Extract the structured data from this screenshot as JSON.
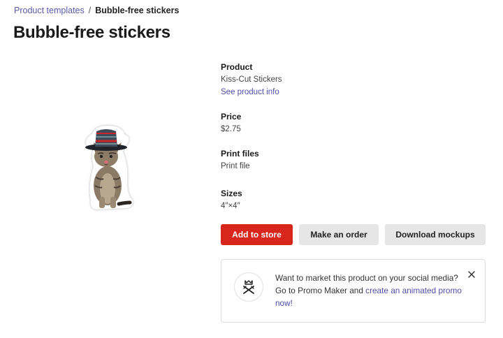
{
  "breadcrumb": {
    "parent": "Product templates",
    "separator": "/",
    "current": "Bubble-free stickers"
  },
  "page_title": "Bubble-free stickers",
  "product_image": {
    "icon": "kitten-sticker-image"
  },
  "info": {
    "product_label": "Product",
    "product_value": "Kiss-Cut Stickers",
    "product_link": "See product info",
    "price_label": "Price",
    "price_value": "$2.75",
    "print_files_label": "Print files",
    "print_files_value": "Print file",
    "sizes_label": "Sizes",
    "sizes_value": "4″×4″"
  },
  "actions": {
    "add_to_store": "Add to store",
    "make_order": "Make an order",
    "download_mockups": "Download mockups"
  },
  "promo": {
    "icon": "promo-maker-icon",
    "line1": "Want to market this product on your social media?",
    "line2_prefix": "Go to Promo Maker and ",
    "link_text": "create an animated promo",
    "link_suffix": "now!",
    "close_icon": "close-icon"
  },
  "colors": {
    "accent": "#d9261c",
    "link": "#4f4fa8",
    "secondary_button": "#e6e6e6"
  }
}
